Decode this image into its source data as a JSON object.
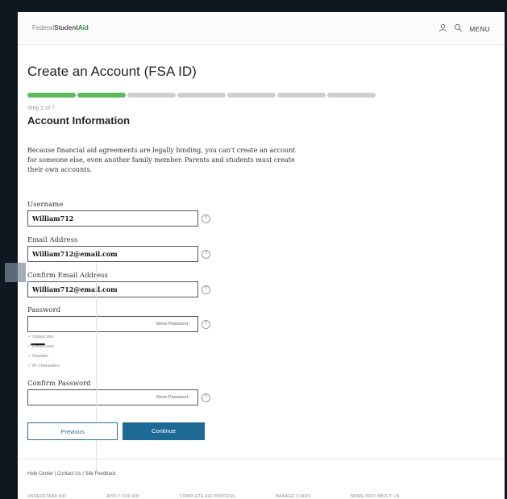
{
  "header": {
    "brand_prefix": "Federal",
    "brand_student": "Student",
    "brand_aid": "Aid",
    "menu_label": "MENU",
    "icons": [
      "user-icon",
      "search-icon"
    ]
  },
  "page": {
    "title": "Create an Account (FSA ID)",
    "progress": {
      "current_step": 2,
      "total_steps": 7
    },
    "step_label": "Step 2 of 7",
    "section_title": "Account Information",
    "intro": "Because financial aid agreements are legally binding, you can't create an account for someone else, even another family member. Parents and students must create their own accounts."
  },
  "form": {
    "username": {
      "label": "Username",
      "value": "William712"
    },
    "email": {
      "label": "Email Address",
      "value": "William712@email.com"
    },
    "confirm_email": {
      "label": "Confirm Email Address",
      "value": "William712@email.com"
    },
    "password": {
      "label": "Password",
      "masked": "••••••••",
      "show_label": "Show Password"
    },
    "requirements": [
      "Uppercase",
      "Lowercase",
      "Number",
      "8+ characters"
    ],
    "confirm_password": {
      "label": "Confirm Password",
      "show_label": "Show Password"
    },
    "help_glyph": "?"
  },
  "buttons": {
    "previous": "Previous",
    "continue": "Continue"
  },
  "footer": {
    "links": "Help Center | Contact Us | Site Feedback",
    "nav": [
      "UNDERSTAND AID",
      "APPLY FOR AID",
      "COMPLETE AID PROCESS",
      "MANAGE LOANS",
      "MORE INFO ABOUT US"
    ]
  },
  "colors": {
    "progress_done": "#5cb85c",
    "primary": "#1d6a96",
    "brand_green": "#2f8f3a"
  }
}
